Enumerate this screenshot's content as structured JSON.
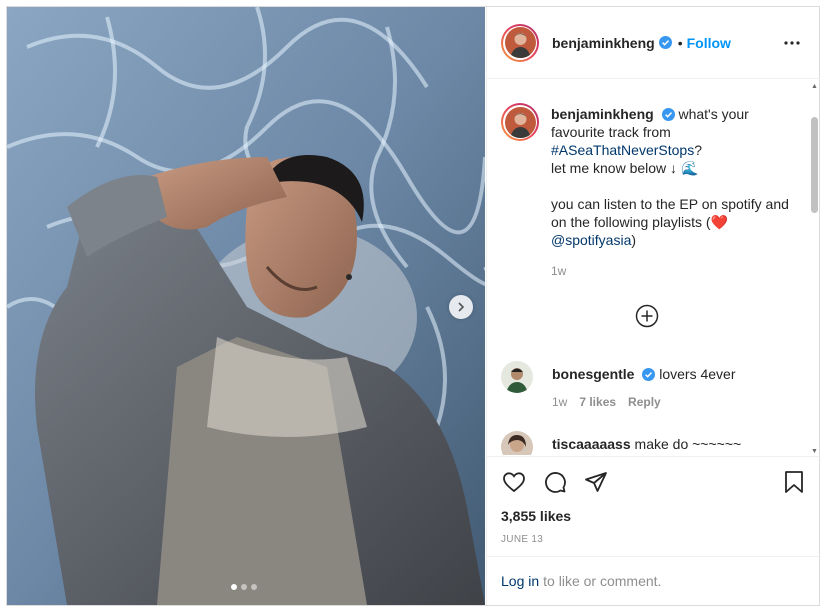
{
  "post": {
    "username": "benjaminkheng",
    "separator": "•",
    "follow_label": "Follow",
    "more_icon": "more-horizontal-icon"
  },
  "caption": {
    "username": "benjaminkheng",
    "line1": "what's your favourite track from",
    "hashtag": "#ASeaThatNeverStops",
    "line2": "?",
    "line3": "let me know below ↓ 🌊",
    "line4": "you can listen to the EP on spotify and on the following playlists (",
    "heart": "❤️",
    "mention": "@spotifyasia",
    "line5": ")",
    "time": "1w"
  },
  "comments": [
    {
      "username": "bonesgentle",
      "text": "lovers 4ever",
      "time": "1w",
      "likes": "7 likes",
      "reply": "Reply"
    },
    {
      "username": "tiscaaaaass",
      "text": "make do ~~~~~~"
    }
  ],
  "engagement": {
    "likes": "3,855 likes",
    "date": "JUNE 13"
  },
  "login": {
    "link": "Log in",
    "text": "to like or comment."
  },
  "carousel": {
    "slides_total": 3,
    "active_slide": 1
  },
  "colors": {
    "accent": "#0095f6",
    "verified": "#3897f0",
    "link": "#00376b"
  }
}
